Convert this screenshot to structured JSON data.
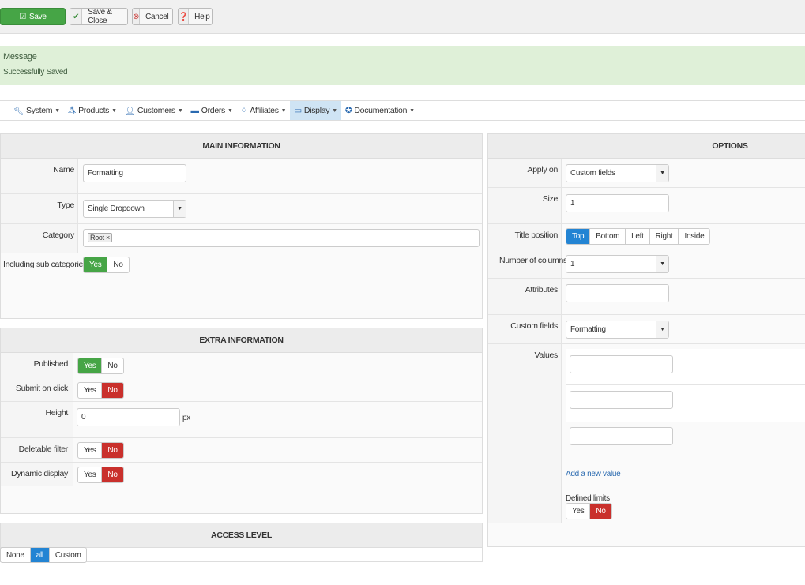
{
  "toolbar": {
    "save": "Save",
    "save_close": "Save & Close",
    "cancel": "Cancel",
    "help": "Help"
  },
  "message": {
    "title": "Message",
    "text": "Successfully Saved"
  },
  "menu": [
    {
      "label": "System",
      "icon": "wrench-icon"
    },
    {
      "label": "Products",
      "icon": "cubes-icon"
    },
    {
      "label": "Customers",
      "icon": "user-icon"
    },
    {
      "label": "Orders",
      "icon": "credit-card-icon"
    },
    {
      "label": "Affiliates",
      "icon": "users-icon"
    },
    {
      "label": "Display",
      "icon": "monitor-icon"
    },
    {
      "label": "Documentation",
      "icon": "lifebuoy-icon"
    }
  ],
  "main": {
    "title": "MAIN INFORMATION",
    "name_label": "Name",
    "name_value": "Formatting",
    "type_label": "Type",
    "type_value": "Single Dropdown",
    "category_label": "Category",
    "category_tag": "Root",
    "sub_label": "Including sub categories",
    "yes": "Yes",
    "no": "No",
    "sub_selected": "Yes"
  },
  "extra": {
    "title": "EXTRA INFORMATION",
    "published_label": "Published",
    "published": "Yes",
    "submit_label": "Submit on click",
    "submit": "No",
    "height_label": "Height",
    "height_value": "0",
    "height_unit": "px",
    "deletable_label": "Deletable filter",
    "deletable": "No",
    "dynamic_label": "Dynamic display",
    "dynamic": "No",
    "yes": "Yes",
    "no": "No"
  },
  "access": {
    "title": "ACCESS LEVEL",
    "options": [
      "None",
      "all",
      "Custom"
    ],
    "selected": "all"
  },
  "options": {
    "title": "OPTIONS",
    "apply_label": "Apply on",
    "apply_value": "Custom fields",
    "size_label": "Size",
    "size_value": "1",
    "title_pos_label": "Title position",
    "title_pos_options": [
      "Top",
      "Bottom",
      "Left",
      "Right",
      "Inside"
    ],
    "title_pos_selected": "Top",
    "columns_label": "Number of columns",
    "columns_value": "1",
    "attributes_label": "Attributes",
    "attributes_value": "",
    "custom_label": "Custom fields",
    "custom_value": "Formatting",
    "values_label": "Values",
    "values": [
      "",
      "",
      ""
    ],
    "add_value": "Add a new value",
    "limits_label": "Defined limits",
    "limits": "No",
    "yes": "Yes",
    "no": "No"
  }
}
